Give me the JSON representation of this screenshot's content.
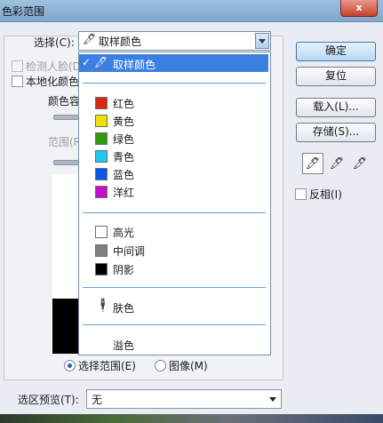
{
  "window": {
    "title": "色彩范围",
    "close_label": "x"
  },
  "select": {
    "label": "选择(C):",
    "value": "取样颜色"
  },
  "options": {
    "detect_faces": "检测人脸(D)",
    "localized_clusters": "本地化颜色",
    "fuzziness_label": "颜色容",
    "range_label": "范围(R"
  },
  "dropdown": {
    "selected": "取样颜色",
    "colors": [
      {
        "label": "红色",
        "color": "#d42b10"
      },
      {
        "label": "黄色",
        "color": "#f0e000"
      },
      {
        "label": "绿色",
        "color": "#2f9a0a"
      },
      {
        "label": "青色",
        "color": "#1ec8f2"
      },
      {
        "label": "蓝色",
        "color": "#0a58e8"
      },
      {
        "label": "洋红",
        "color": "#c410c8"
      }
    ],
    "tones": [
      {
        "label": "高光",
        "color": "#ffffff"
      },
      {
        "label": "中间调",
        "color": "#808080"
      },
      {
        "label": "阴影",
        "color": "#000000"
      }
    ],
    "skin": "肤色",
    "out_of_gamut": "溢色"
  },
  "buttons": {
    "ok": "确定",
    "reset": "复位",
    "load": "载入(L)...",
    "save": "存储(S)..."
  },
  "invert": "反相(I)",
  "radios": {
    "selection": "选择范围(E)",
    "image": "图像(M)"
  },
  "selection_preview": {
    "label": "选区预览(T):",
    "value": "无"
  }
}
